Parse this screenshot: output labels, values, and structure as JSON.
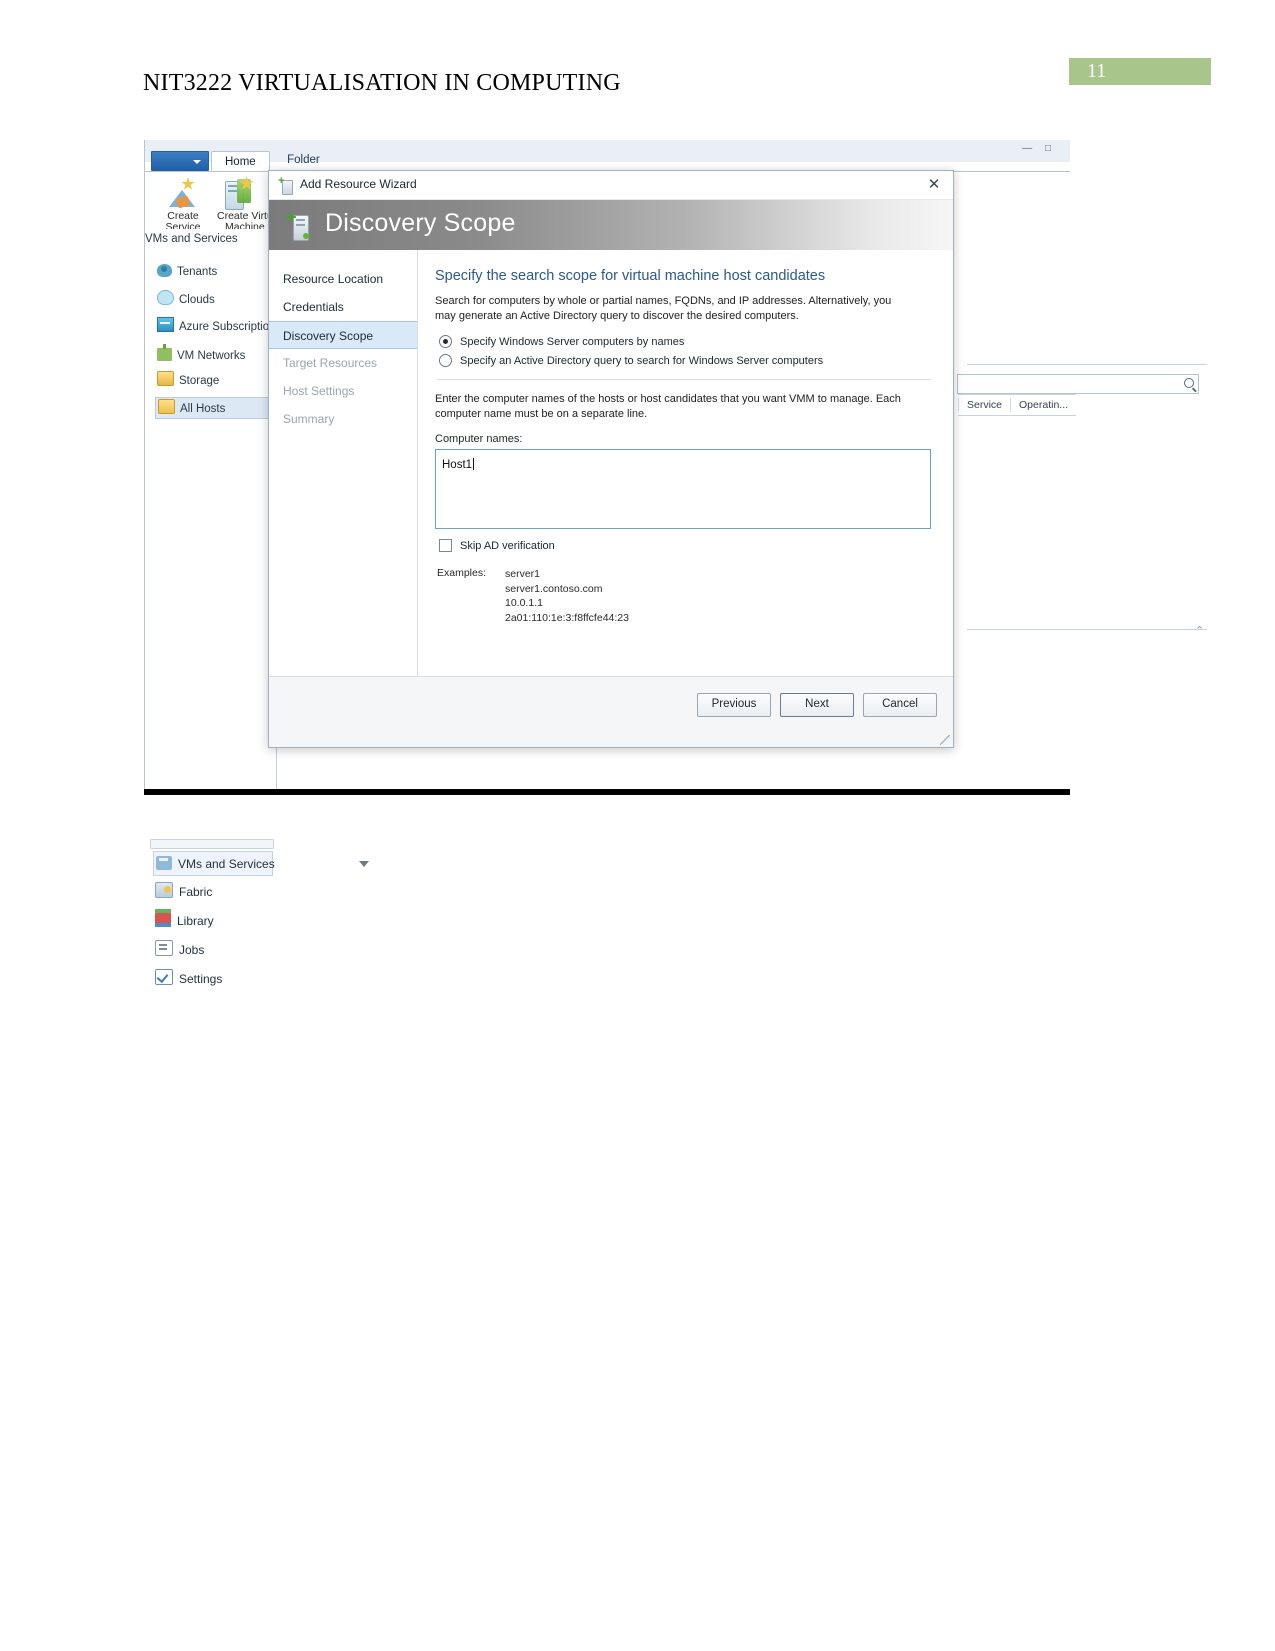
{
  "document": {
    "title": "NIT3222 VIRTUALISATION IN COMPUTING",
    "page_number": "11",
    "badge_color": "#a8c58c"
  },
  "vmm": {
    "ribbon": {
      "tabs": [
        {
          "label": "Home",
          "active": true
        },
        {
          "label": "Folder",
          "active": false
        }
      ],
      "buttons": [
        {
          "label_line1": "Create",
          "label_line2": "Service",
          "icon": "create-service-icon"
        },
        {
          "label_line1": "Create Virtual",
          "label_line2": "Machine ▾",
          "icon": "create-virtual-machine-icon"
        }
      ],
      "window_controls": "—  □"
    },
    "nav": {
      "header": "VMs and Services",
      "items": [
        {
          "label": "Tenants",
          "icon": "tenants-icon",
          "selected": false
        },
        {
          "label": "Clouds",
          "icon": "clouds-icon",
          "selected": false
        },
        {
          "label": "Azure Subscription",
          "icon": "azure-subscription-icon",
          "selected": false
        },
        {
          "label": "VM Networks",
          "icon": "vm-networks-icon",
          "selected": false
        },
        {
          "label": "Storage",
          "icon": "storage-icon",
          "selected": false
        },
        {
          "label": "All Hosts",
          "icon": "all-hosts-icon",
          "selected": true
        }
      ]
    },
    "workspaces": [
      {
        "label": "VMs and Services",
        "icon": "vms-and-services-icon",
        "active": true
      },
      {
        "label": "Fabric",
        "icon": "fabric-icon",
        "active": false
      },
      {
        "label": "Library",
        "icon": "library-icon",
        "active": false
      },
      {
        "label": "Jobs",
        "icon": "jobs-icon",
        "active": false
      },
      {
        "label": "Settings",
        "icon": "settings-icon",
        "active": false
      }
    ],
    "grid": {
      "columns": [
        "Service",
        "Operatin..."
      ]
    }
  },
  "dialog": {
    "window_title": "Add Resource Wizard",
    "close_label": "✕",
    "header_title": "Discovery Scope",
    "steps": [
      {
        "label": "Resource Location",
        "state": "done"
      },
      {
        "label": "Credentials",
        "state": "done"
      },
      {
        "label": "Discovery Scope",
        "state": "active"
      },
      {
        "label": "Target Resources",
        "state": "disabled"
      },
      {
        "label": "Host Settings",
        "state": "disabled"
      },
      {
        "label": "Summary",
        "state": "disabled"
      }
    ],
    "pane": {
      "title": "Specify the search scope for virtual machine host candidates",
      "description": "Search for computers by whole or partial names, FQDNs, and IP addresses. Alternatively, you may generate an Active Directory query to discover the desired computers.",
      "radio_options": [
        {
          "label": "Specify Windows Server computers by names",
          "checked": true
        },
        {
          "label": "Specify an Active Directory query to search for Windows Server computers",
          "checked": false
        }
      ],
      "instruction": "Enter the computer names of the hosts or host candidates that you want VMM to manage. Each computer name must be on a separate line.",
      "field_label": "Computer names:",
      "computer_names_value": "Host1",
      "skip_ad_label": "Skip AD verification",
      "skip_ad_checked": false,
      "examples_label": "Examples:",
      "examples": [
        "server1",
        "server1.contoso.com",
        "10.0.1.1",
        "2a01:110:1e:3:f8ffcfe44:23"
      ]
    },
    "footer": {
      "previous": "Previous",
      "next": "Next",
      "cancel": "Cancel"
    }
  }
}
